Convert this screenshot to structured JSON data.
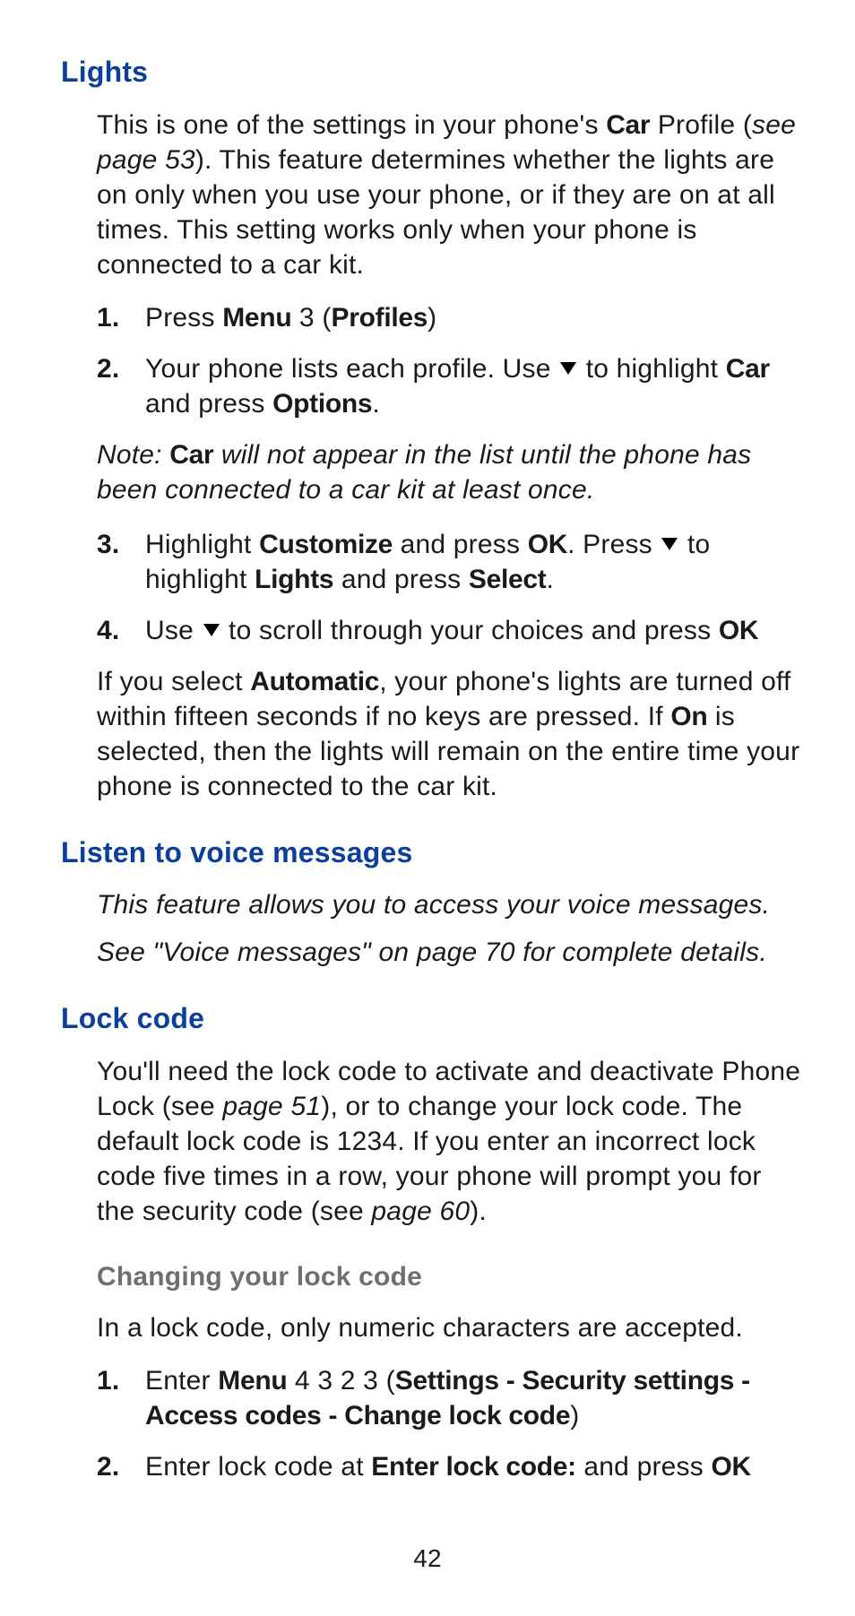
{
  "lights": {
    "heading": "Lights",
    "intro_1a": "This is one of the settings in your phone's ",
    "intro_bold_car": "Car",
    "intro_1b": " Profile (",
    "intro_ital_ref": "see page 53",
    "intro_1c": "). This feature determines whether the lights are on only when you use your phone, or if they are on at all times. This setting works only when your phone is connected to a car kit.",
    "s1a": "Press ",
    "s1_menu": "Menu",
    "s1b": " 3 (",
    "s1_profiles": "Profiles",
    "s1c": ")",
    "s2a": "Your phone lists each profile. Use ",
    "s2b": " to highlight ",
    "s2_car": "Car",
    "s2c": " and press ",
    "s2_options": "Options",
    "s2d": ".",
    "note_a": "Note: ",
    "note_car": "Car",
    "note_b": " will not appear in the list until the phone has been connected to a car kit at least once.",
    "s3a": "Highlight ",
    "s3_customize": "Customize",
    "s3b": " and press ",
    "s3_ok1": "OK",
    "s3c": ". Press ",
    "s3d": " to highlight ",
    "s3_lights": "Lights",
    "s3e": " and press ",
    "s3_select": "Select",
    "s3f": ".",
    "s4a": "Use ",
    "s4b": " to scroll through your choices and press ",
    "s4_ok": "OK",
    "closing_a": "If you select ",
    "closing_auto": "Automatic",
    "closing_b": ", your phone's lights are turned off within fifteen seconds if no keys are pressed. If ",
    "closing_on": "On",
    "closing_c": " is selected, then the lights will remain on the entire time your phone is connected to the car kit."
  },
  "voice": {
    "heading": "Listen to voice messages",
    "line1": "This feature allows you to access your voice messages.",
    "line2": "See \"Voice messages\" on page 70 for complete details."
  },
  "lock": {
    "heading": "Lock code",
    "p_a": "You'll need the lock code to activate and deactivate Phone Lock (see ",
    "p_ref1": "page 51",
    "p_b": "), or to change your lock code. The default lock code is 1234. If you enter an incorrect lock code five times in a row, your phone will prompt you for the security code (see ",
    "p_ref2": "page 60",
    "p_c": ").",
    "sub_heading": "Changing your lock code",
    "sub_intro": "In a lock code, only numeric characters are accepted.",
    "s1a": "Enter ",
    "s1_menu": "Menu",
    "s1b": " 4 3 2 3 (",
    "s1_path": "Settings - Security settings - Access codes - Change lock code",
    "s1c": ")",
    "s2a": "Enter lock code at ",
    "s2_prompt": "Enter lock code:",
    "s2b": " and press ",
    "s2_ok": "OK"
  },
  "page_number": "42"
}
